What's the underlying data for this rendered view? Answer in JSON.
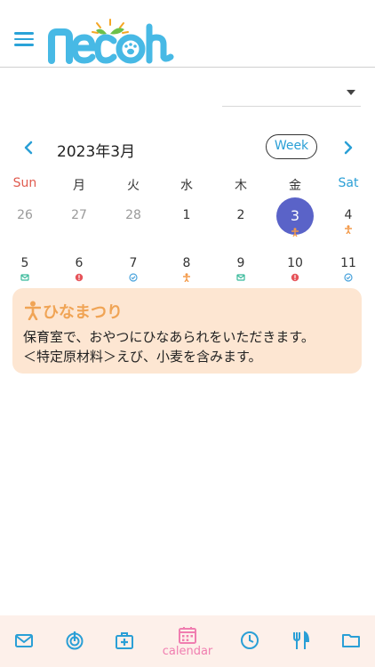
{
  "header": {
    "logo_text": "necoh"
  },
  "dropdown": {
    "value": ""
  },
  "month_nav": {
    "month": "2023年3月",
    "view_button": "Week"
  },
  "weekdays": [
    "Sun",
    "月",
    "火",
    "水",
    "木",
    "金",
    "Sat"
  ],
  "calendar": {
    "week1": [
      "26",
      "27",
      "28",
      "1",
      "2",
      "3",
      "4"
    ],
    "week2": [
      "5",
      "6",
      "7",
      "8",
      "9",
      "10",
      "11"
    ]
  },
  "event": {
    "title": "ひなまつり",
    "line1": "保育室で、おやつにひなあられをいただきます。",
    "line2": "＜特定原材料＞えび、小麦を含みます。"
  },
  "tabbar": {
    "active_label": "calendar"
  },
  "colors": {
    "accent_blue": "#2aa3d8",
    "today_circle": "#5a63c8",
    "event_bg": "#fde6d2",
    "event_title": "#f0a455",
    "tab_active": "#f07eb0",
    "sunday": "#e05a4e"
  }
}
